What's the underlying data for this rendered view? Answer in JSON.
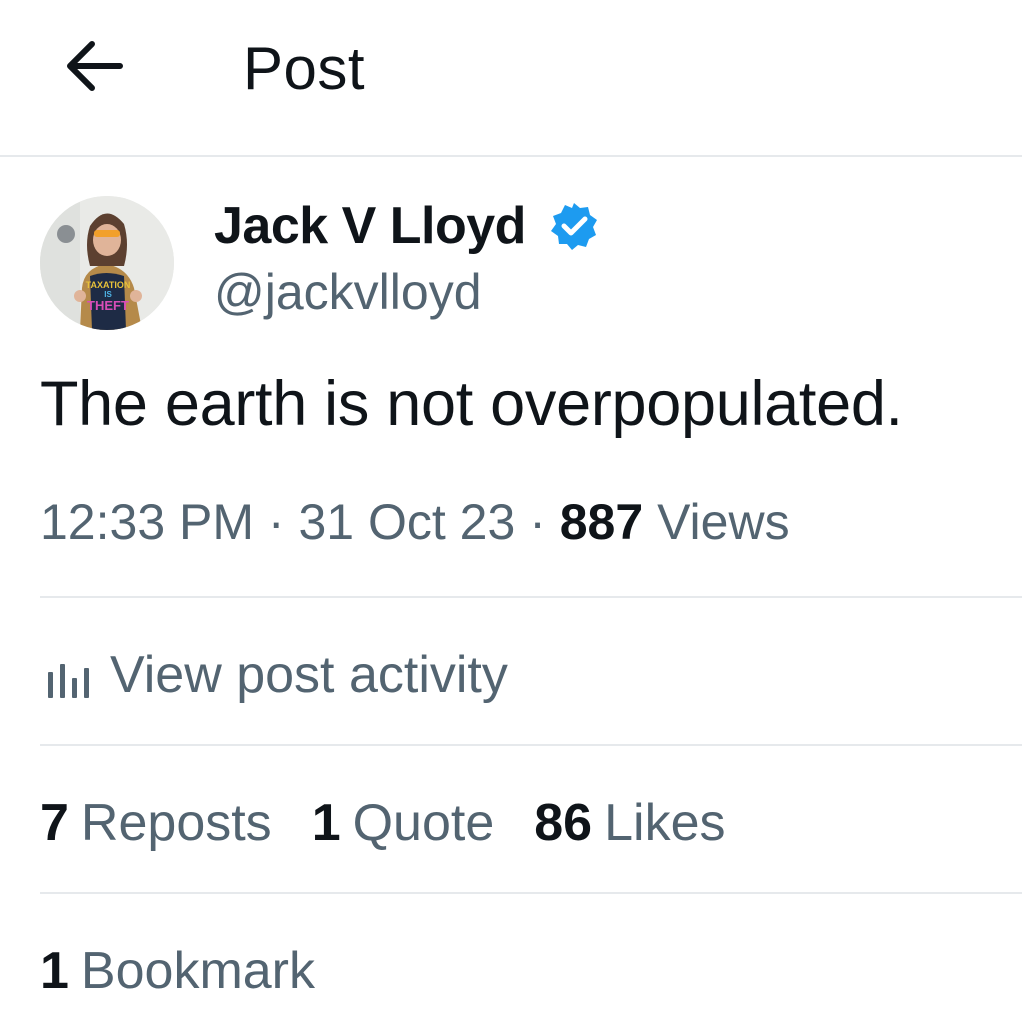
{
  "header": {
    "title": "Post",
    "back_icon": "arrow-left-icon"
  },
  "author": {
    "display_name": "Jack V Lloyd",
    "handle": "@jackvlloyd",
    "verified_icon": "verified-badge-icon",
    "verified_color": "#1d9bf0",
    "avatar_shirt_text": [
      "TAXATION",
      "IS",
      "THEFT"
    ]
  },
  "post": {
    "text": "The earth is not overpopulated."
  },
  "meta": {
    "time": "12:33 PM",
    "separator": "·",
    "date": "31 Oct 23",
    "views_count": "887",
    "views_label": "Views"
  },
  "activity": {
    "label": "View post activity",
    "icon": "bar-chart-icon"
  },
  "stats": {
    "reposts_count": "7",
    "reposts_label": "Reposts",
    "quotes_count": "1",
    "quotes_label": "Quote",
    "likes_count": "86",
    "likes_label": "Likes"
  },
  "bookmarks": {
    "count": "1",
    "label": "Bookmark"
  },
  "colors": {
    "text": "#0f1419",
    "secondary": "#536471",
    "divider": "#e6e9ec"
  }
}
